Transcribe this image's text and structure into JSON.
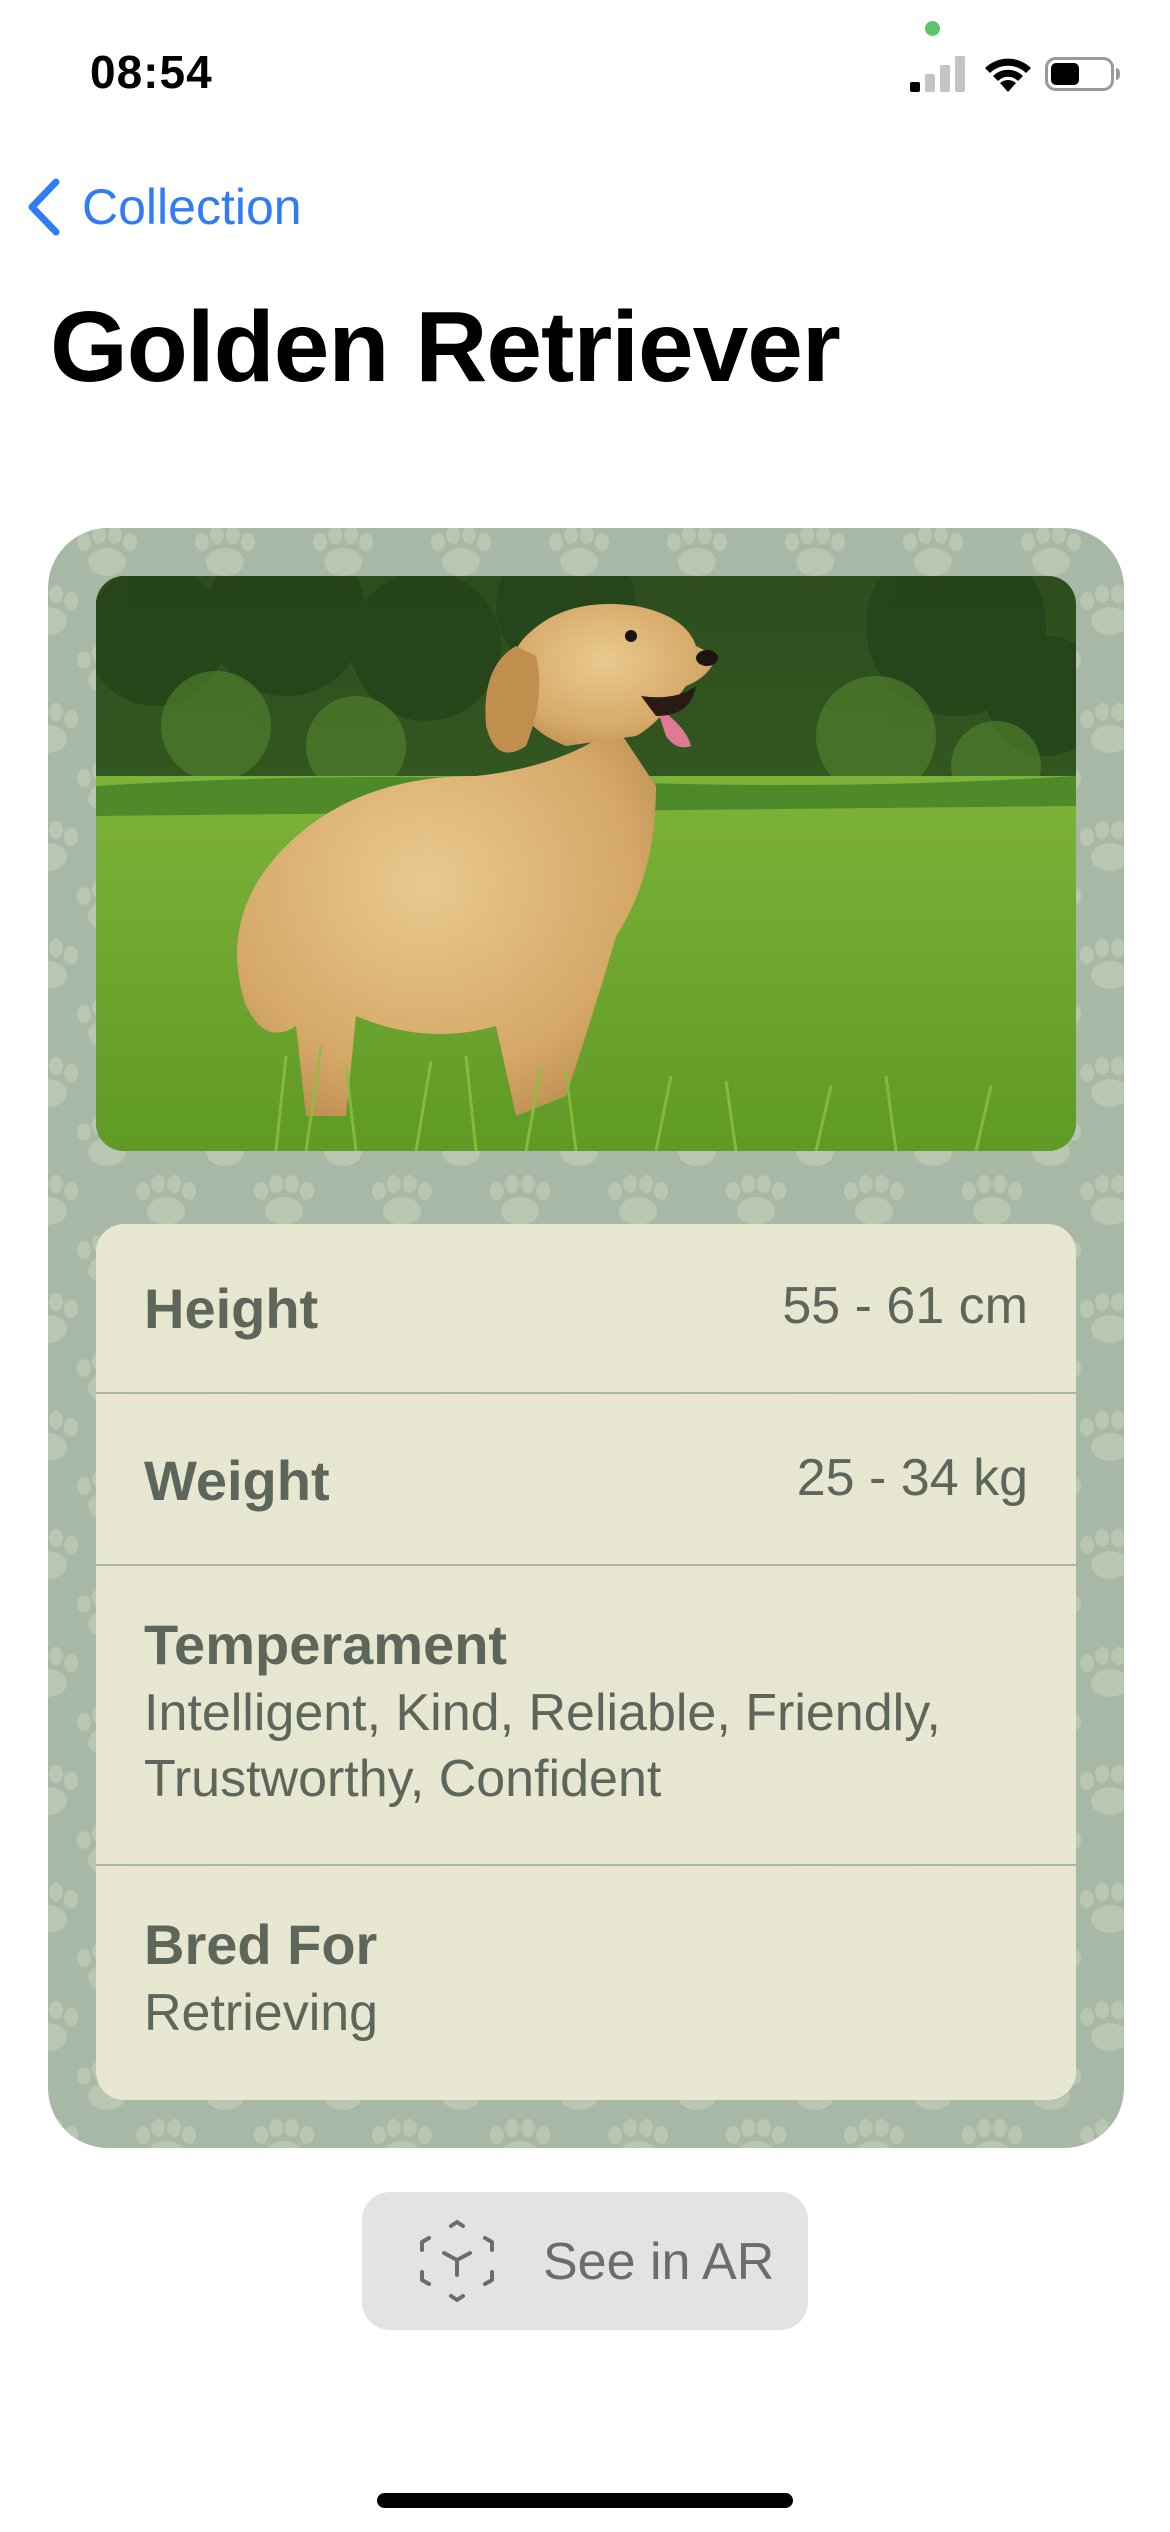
{
  "status_bar": {
    "time": "08:54",
    "signal_icon": "cellular-signal-icon",
    "wifi_icon": "wifi-icon",
    "battery_icon": "battery-icon",
    "indicator_color": "#5ec46b"
  },
  "nav": {
    "back_label": "Collection",
    "back_icon": "chevron-left-icon",
    "accent_color": "#2f7cf6"
  },
  "title": "Golden Retriever",
  "card": {
    "background_color": "#a8b8a6",
    "photo": "golden-retriever-photo",
    "stats": {
      "height": {
        "label": "Height",
        "value": "55 - 61 cm"
      },
      "weight": {
        "label": "Weight",
        "value": "25 - 34 kg"
      },
      "temperament": {
        "label": "Temperament",
        "value": "Intelligent, Kind, Reliable, Friendly, Trustworthy, Confident"
      },
      "bred_for": {
        "label": "Bred For",
        "value": "Retrieving"
      }
    }
  },
  "ar_button": {
    "label": "See in AR",
    "icon": "ar-cube-icon"
  }
}
